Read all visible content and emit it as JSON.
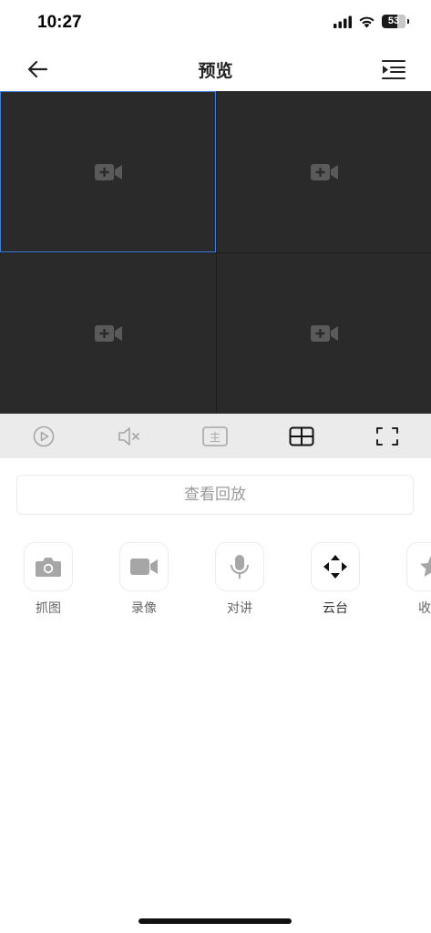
{
  "status_bar": {
    "time": "10:27",
    "battery": "53"
  },
  "nav": {
    "title": "预览"
  },
  "icons": {
    "back": "arrow-left-icon",
    "menu": "list-menu-icon",
    "camera_add": "camera-add-icon",
    "play": "play-icon",
    "mute": "mute-icon",
    "stream": "main-stream-icon",
    "layout": "quad-layout-icon",
    "fullscreen": "fullscreen-icon"
  },
  "colors": {
    "selected_border": "#3b7fe0",
    "grid_bg": "#2a2a2a",
    "ctrl_bg": "#ebebeb"
  },
  "controls": {
    "stream_label": "主"
  },
  "playback": {
    "label": "查看回放"
  },
  "functions": [
    {
      "label": "抓图"
    },
    {
      "label": "录像"
    },
    {
      "label": "对讲"
    },
    {
      "label": "云台"
    },
    {
      "label": "收藏"
    }
  ]
}
